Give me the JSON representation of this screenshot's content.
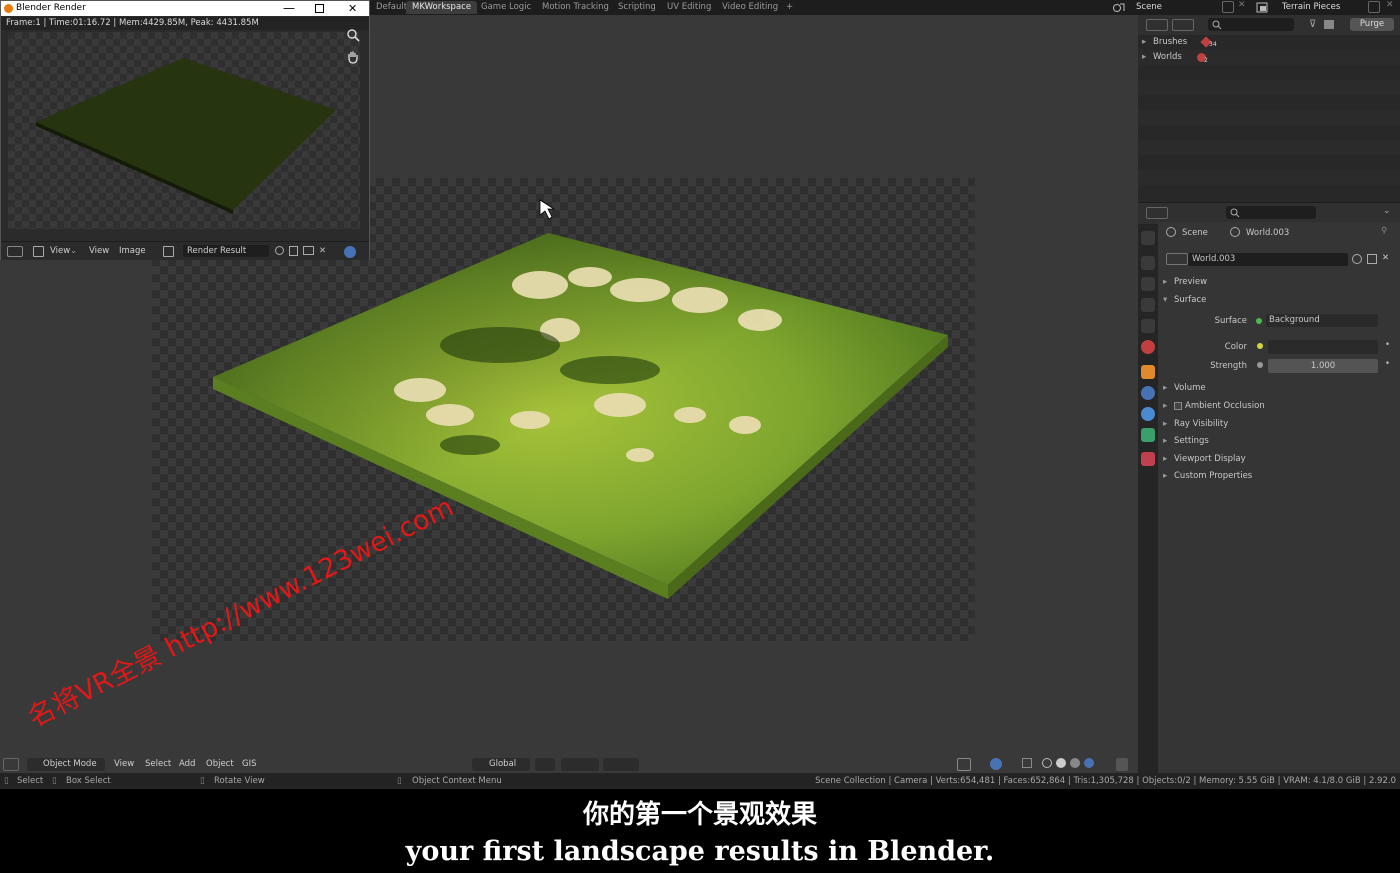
{
  "workspace_tabs": [
    "Default",
    "MKWorkspace",
    "Game Logic",
    "Motion Tracking",
    "Scripting",
    "UV Editing",
    "Video Editing",
    "+"
  ],
  "active_tab": "MKWorkspace",
  "scene": {
    "label": "Scene",
    "view_layer": "Terrain Pieces"
  },
  "render_window": {
    "title": "Blender Render",
    "info": "Frame:1 | Time:01:16.72 | Mem:4429.85M, Peak: 4431.85M",
    "menu": {
      "view1": "View",
      "view2": "View",
      "image": "Image",
      "slot": "Render Result"
    }
  },
  "viewport": {
    "mode": "Object Mode",
    "menu": [
      "View",
      "Select",
      "Add",
      "Object",
      "GIS"
    ],
    "orientation": "Global"
  },
  "status": {
    "select": "Select",
    "box_select": "Box Select",
    "rotate": "Rotate View",
    "context": "Object Context Menu",
    "stats": "Scene Collection | Camera | Verts:654,481 | Faces:652,864 | Tris:1,305,728 | Objects:0/2 | Memory: 5.55 GiB | VRAM: 4.1/8.0 GiB | 2.92.0"
  },
  "outliner": {
    "purge": "Purge",
    "items": [
      {
        "label": "Brushes",
        "count": "34"
      },
      {
        "label": "Worlds",
        "count": "2"
      }
    ]
  },
  "properties": {
    "breadcrumb_scene": "Scene",
    "breadcrumb_world": "World.003",
    "world_name": "World.003",
    "panels": [
      "Preview",
      "Surface"
    ],
    "surface_label": "Surface",
    "surface_value": "Background",
    "color_label": "Color",
    "strength_label": "Strength",
    "strength_value": "1.000",
    "more_panels": [
      "Volume",
      "Ambient Occlusion",
      "Ray Visibility",
      "Settings",
      "Viewport Display",
      "Custom Properties"
    ]
  },
  "subtitle": {
    "cn": "你的第一个景观效果",
    "en": "your first landscape results in Blender."
  },
  "watermark": "名将VR全景 http://www.123wei.com",
  "colors": {
    "accent": "#4772b3",
    "terrain": "#7fa832",
    "rock": "#e8dcb0"
  }
}
